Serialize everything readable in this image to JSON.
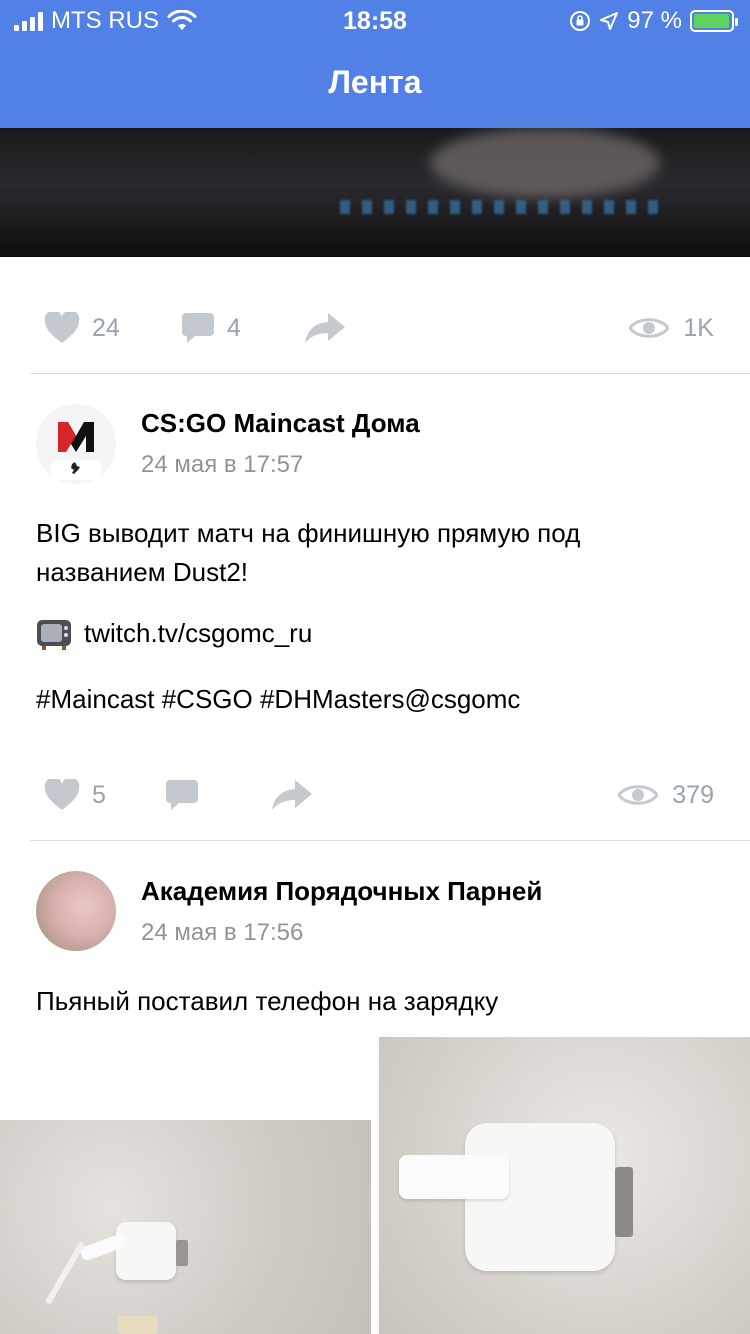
{
  "status_bar": {
    "carrier": "MTS RUS",
    "time": "18:58",
    "battery": "97 %",
    "battery_level": 0.97
  },
  "nav": {
    "title": "Лента"
  },
  "post0": {
    "likes": "24",
    "comments": "4",
    "views": "1K"
  },
  "post1": {
    "author": "CS:GO Maincast Дома",
    "date": "24 мая в 17:57",
    "text_line1": "BIG выводит матч на финишную прямую под",
    "text_line2": "названием Dust2!",
    "link": "twitch.tv/csgomc_ru",
    "hashtags": "#Maincast #CSGO #DHMasters@csgomc",
    "likes": "5",
    "views": "379"
  },
  "post2": {
    "author": "Академия Порядочных Парней",
    "date": "24 мая в 17:56",
    "text": "Пьяный поставил телефон на зарядку"
  },
  "icons": {
    "like": "heart-icon",
    "comment": "comment-icon",
    "share": "share-arrow-icon",
    "views": "eye-icon",
    "tv": "television-icon"
  },
  "colors": {
    "header": "#5181e6",
    "muted": "#99a2ad",
    "meta": "#909499"
  }
}
